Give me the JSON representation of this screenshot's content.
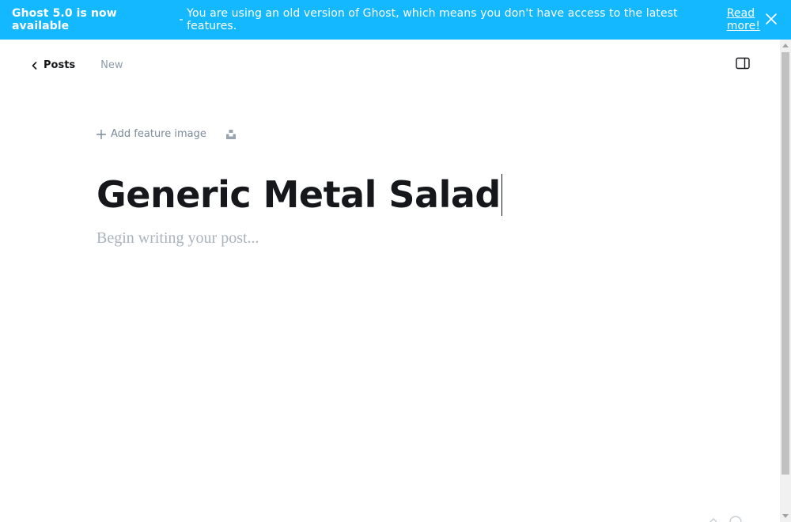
{
  "banner": {
    "bold_text": "Ghost 5.0 is now available",
    "separator": " - ",
    "message": "You are using an old version of Ghost, which means you don't have access to the latest features.",
    "link_text": "Read more!",
    "background": "#14b8ff",
    "close_icon": "close-icon"
  },
  "header": {
    "back_label": "Posts",
    "status": "New",
    "back_icon": "chevron-left-icon",
    "settings_icon": "sidebar-toggle-icon"
  },
  "feature_image": {
    "add_label": "Add feature image",
    "add_icon": "plus-icon",
    "unsplash_icon": "unsplash-icon"
  },
  "post": {
    "title": "Generic Metal Salad",
    "body_placeholder": "Begin writing your post..."
  }
}
